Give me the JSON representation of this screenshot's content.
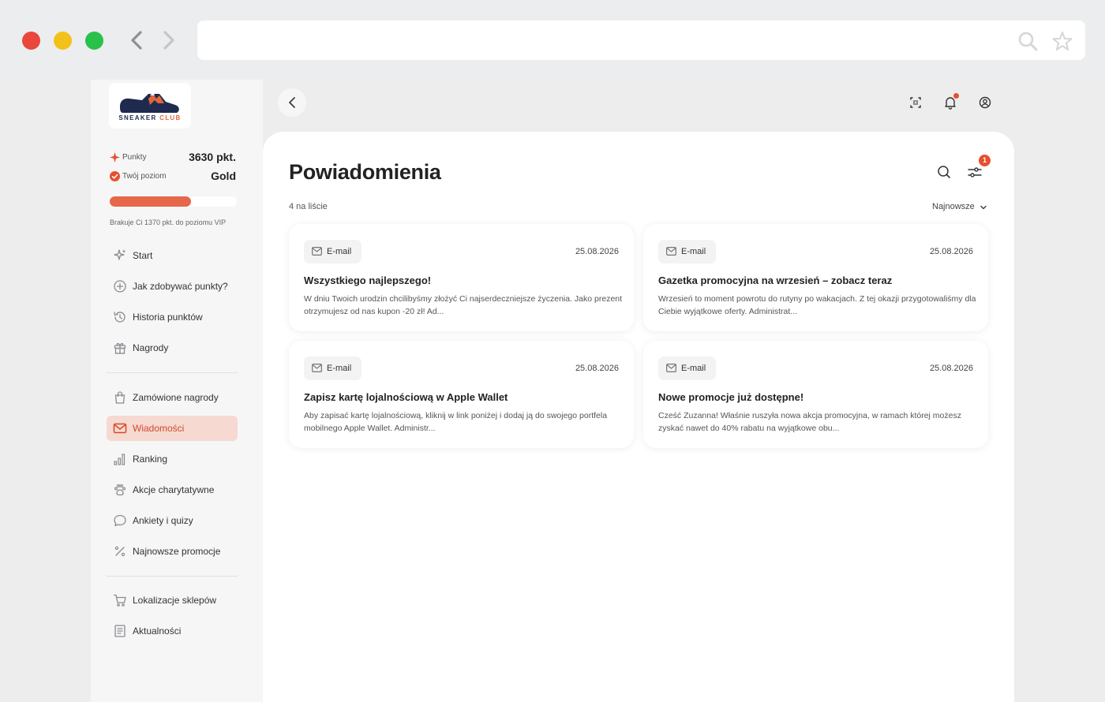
{
  "browser": {
    "address": "",
    "icons": [
      "back-arrow-icon",
      "forward-arrow-icon",
      "search-icon",
      "star-icon"
    ]
  },
  "brand": {
    "logo_line1": "SNEAKER",
    "logo_line2": "CLUB",
    "colors": {
      "navy": "#1e2b4f",
      "accent": "#e0663b"
    }
  },
  "stats": {
    "points_label": "Punkty",
    "points_value": "3630 pkt.",
    "level_label": "Twój poziom",
    "level_value": "Gold",
    "progress": 0.64,
    "progress_note": "Brakuje Ci 1370 pkt. do poziomu VIP"
  },
  "nav": {
    "items": [
      {
        "label": "Start",
        "icon": "sparkles-icon"
      },
      {
        "label": "Jak zdobywać punkty?",
        "icon": "plus-circle-icon"
      },
      {
        "label": "Historia punktów",
        "icon": "history-icon"
      },
      {
        "label": "Nagrody",
        "icon": "gift-icon"
      },
      {
        "label": "Zamówione nagrody",
        "icon": "bag-icon"
      },
      {
        "label": "Wiadomości",
        "icon": "mail-icon",
        "active": true
      },
      {
        "label": "Ranking",
        "icon": "bar-chart-icon"
      },
      {
        "label": "Akcje charytatywne",
        "icon": "paw-icon"
      },
      {
        "label": "Ankiety i quizy",
        "icon": "chat-bubble-icon"
      },
      {
        "label": "Najnowsze promocje",
        "icon": "percent-icon"
      },
      {
        "label": "Lokalizacje sklepów",
        "icon": "cart-icon"
      },
      {
        "label": "Aktualności",
        "icon": "newspaper-icon"
      }
    ]
  },
  "header": {
    "icons": [
      "back-chevron-icon",
      "scan-icon",
      "bell-icon",
      "user-circle-icon"
    ],
    "notification_dot_color": "#e6502d"
  },
  "main": {
    "title": "Powiadomienia",
    "count_text": "4 na liście",
    "sort_label": "Najnowsze",
    "filter_badge": "1",
    "cards": [
      {
        "tag": "E-mail",
        "date": "25.08.2026",
        "title": "Wszystkiego najlepszego!",
        "body": "W dniu Twoich urodzin chcilibyśmy złożyć Ci najserdeczniejsze życzenia. Jako prezent otrzymujesz od nas kupon -20 zł! Ad..."
      },
      {
        "tag": "E-mail",
        "date": "25.08.2026",
        "title": "Gazetka promocyjna na wrzesień – zobacz teraz",
        "body": "Wrzesień to moment powrotu do rutyny po wakacjach. Z tej okazji przygotowaliśmy dla Ciebie wyjątkowe oferty. Administrat..."
      },
      {
        "tag": "E-mail",
        "date": "25.08.2026",
        "title": "Zapisz kartę lojalnościową w Apple Wallet",
        "body": "Aby zapisać kartę lojalnościową, kliknij w link poniżej i dodaj ją do swojego portfela mobilnego Apple Wallet. Administr..."
      },
      {
        "tag": "E-mail",
        "date": "25.08.2026",
        "title": "Nowe promocje już dostępne!",
        "body": "Cześć Zuzanna! Właśnie ruszyła nowa akcja promocyjna, w ramach której możesz zyskać nawet do 40% rabatu na wyjątkowe obu..."
      }
    ]
  }
}
